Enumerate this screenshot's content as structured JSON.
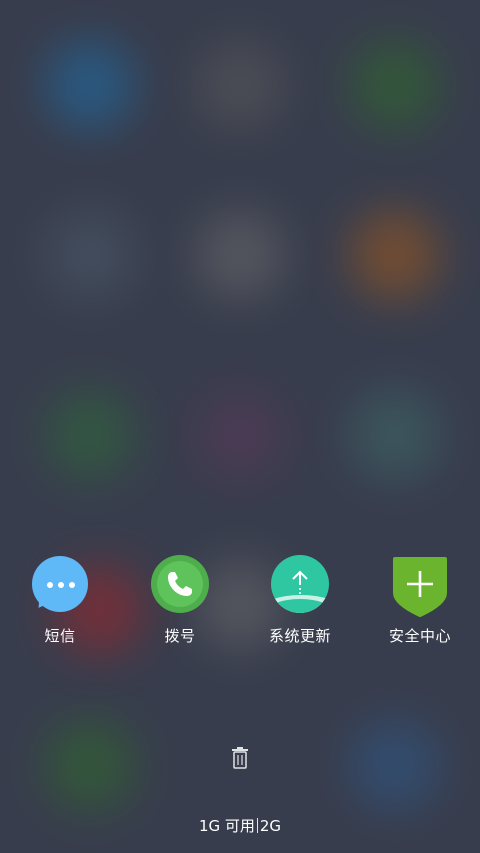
{
  "background": {
    "color": "#383d4d",
    "blurred_app_colors": [
      "#1e6fa8",
      "#5a5a5a",
      "#2f6b2a",
      "#4c5a6a",
      "#6a6a6a",
      "#a05a1e",
      "#2f6b3a",
      "#5a3a5a",
      "#3f6a6a",
      "#a0262a",
      "#6a6a6a",
      "#2f6b2a",
      "#2f5a8a"
    ]
  },
  "recent_apps": [
    {
      "label": "短信",
      "icon": "message-bubble-icon",
      "color": "#5fb9f6"
    },
    {
      "label": "拨号",
      "icon": "phone-icon",
      "color": "#5ec35a"
    },
    {
      "label": "系统更新",
      "icon": "upload-arrow-icon",
      "color": "#2ec7a1"
    },
    {
      "label": "安全中心",
      "icon": "shield-plus-icon",
      "color": "#6ab42e"
    }
  ],
  "clear_button": {
    "icon": "trash-icon"
  },
  "memory": {
    "available": "1G 可用",
    "total": "2G"
  }
}
